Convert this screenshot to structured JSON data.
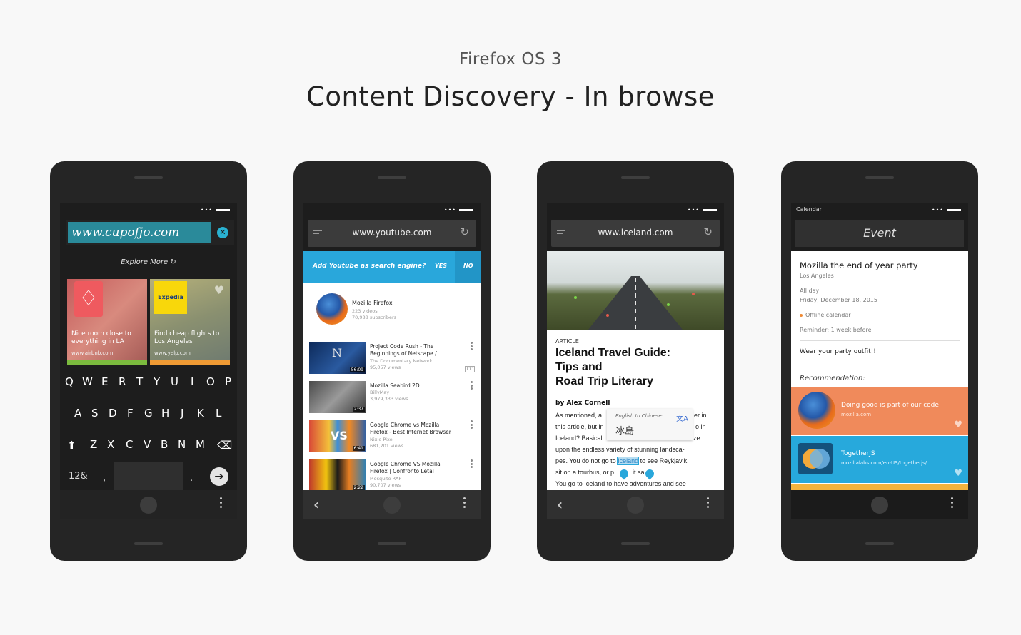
{
  "header": {
    "subtitle": "Firefox OS 3",
    "title": "Content Discovery - In browse"
  },
  "phone1": {
    "url": "www.cupofjo.com",
    "explore_label": "Explore More",
    "cards": [
      {
        "title": "Nice room close to everything in LA",
        "url": "www.airbnb.com",
        "logo": "airbnb-logo"
      },
      {
        "title": "Find cheap flights to Los Angeles",
        "url": "www.yelp.com",
        "logo": "Expedia"
      }
    ],
    "keyboard": {
      "row1": [
        "Q",
        "W",
        "E",
        "R",
        "T",
        "Y",
        "U",
        "I",
        "O",
        "P"
      ],
      "row2": [
        "A",
        "S",
        "D",
        "F",
        "G",
        "H",
        "J",
        "K",
        "L"
      ],
      "row3": [
        "Z",
        "X",
        "C",
        "V",
        "B",
        "N",
        "M"
      ],
      "numbers_key": "12&",
      "comma_key": ",",
      "period_key": "."
    }
  },
  "phone2": {
    "url": "www.youtube.com",
    "banner_text": "Add Youtube as search engine?",
    "yes_label": "YES",
    "no_label": "NO",
    "channel": {
      "name": "Mozilla Firefox",
      "videos": "223 videos",
      "subscribers": "70,988 subscribers"
    },
    "videos": [
      {
        "title": "Project Code Rush - The Beginnings of Netscape /...",
        "author": "The Documentary Network",
        "views": "95,057 views",
        "duration": "56:09",
        "cc": "CC"
      },
      {
        "title": "Mozilla Seabird 2D",
        "author": "BillyMay",
        "views": "3,979,333 views",
        "duration": "2:37"
      },
      {
        "title": "Google Chrome vs Mozilla Firefox - Best Internet Browser",
        "author": "Nixie Pixel",
        "views": "681,201 views",
        "duration": "6:41"
      },
      {
        "title": "Google Chrome VS Mozilla Firefox | Confronto Letal",
        "author": "Mosquito RAP",
        "views": "90,707 views",
        "duration": "2:22"
      }
    ]
  },
  "phone3": {
    "url": "www.iceland.com",
    "article_label": "ARTICLE",
    "headline": [
      "Iceland Travel Guide:",
      "Tips and",
      "Road Trip Literary"
    ],
    "byline": "by Alex Cornell",
    "lines": [
      {
        "pre": "As mentioned, a",
        "post": "er in"
      },
      {
        "pre": "this article, but in",
        "post": "o in"
      },
      {
        "pre": "Iceland? Basicall",
        "post": "ze"
      },
      {
        "pre": "upon the endless variety of stunning landsca-",
        "post": ""
      },
      {
        "pre": "pes. You do not go to ",
        "hl": "Iceland",
        "post": " to see Reykjavik,"
      },
      {
        "pre": "sit on a tourbus, or p",
        "post": "it sa"
      },
      {
        "pre": "You go to Iceland to have adventures and see",
        "post": ""
      }
    ],
    "translate_label": "English to Chinese:",
    "translate_value": "冰島"
  },
  "phone4": {
    "app_label": "Calendar",
    "header_title": "Event",
    "event_title": "Mozilla the end of year party",
    "location": "Los Angeles",
    "all_day": "All day",
    "date": "Friday, December 18, 2015",
    "calendar": "Offline calendar",
    "reminder": "Reminder: 1 week before",
    "note": "Wear your party outfit!!",
    "recommendation_label": "Recommendation:",
    "recommendations": [
      {
        "title": "Doing good is part of our code",
        "url": "mozilla.com"
      },
      {
        "title": "TogetherJS",
        "url": "mozillalabs.com/en-US/togetherjs/"
      }
    ]
  }
}
